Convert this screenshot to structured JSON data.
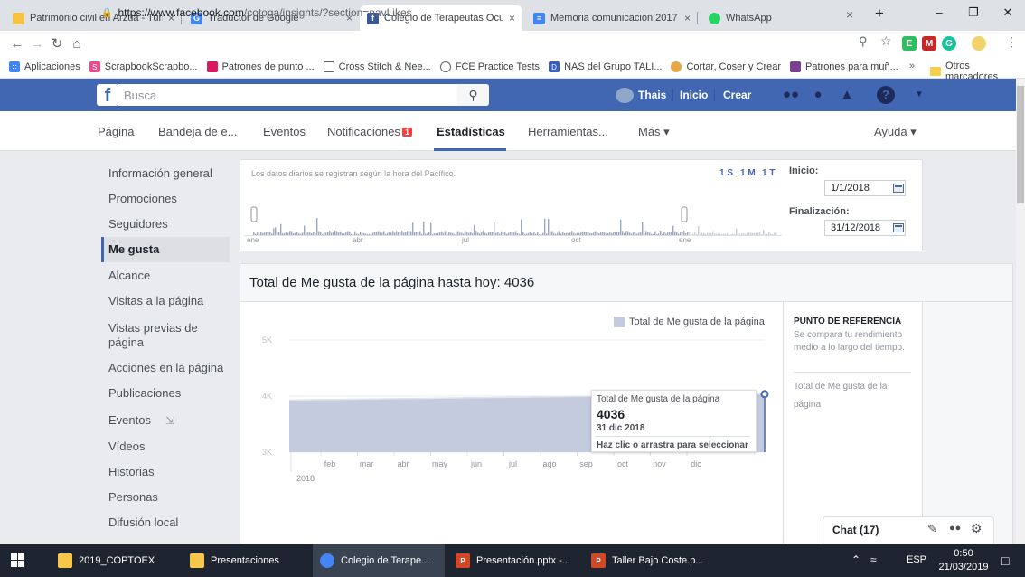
{
  "browser": {
    "tabs": [
      {
        "title": "Patrimonio civil en Arzúa - Turi",
        "close": "×"
      },
      {
        "title": "Traductor de Google",
        "close": "×"
      },
      {
        "title": "Colegio de Terapeutas Ocupac",
        "close": "×"
      },
      {
        "title": "Memoria comunicacion 2017 - ",
        "close": "×"
      },
      {
        "title": "WhatsApp",
        "close": ""
      }
    ],
    "tab_list_close": "×",
    "new_tab": "+",
    "url": "https://www.facebook.com/cotoga/insights/?section=navLikes",
    "url_host": "https://www.facebook.com",
    "url_path": "/cotoga/insights/?section=navLikes",
    "bookmarks": [
      "Aplicaciones",
      "ScrapbookScrapbo...",
      "Patrones de punto ...",
      "Cross Stitch & Nee...",
      "FCE Practice Tests",
      "NAS del Grupo TALI...",
      "Cortar, Coser y Crear",
      "Patrones para muñ..."
    ],
    "bookmarks_more": "»",
    "other_bookmarks": "Otros marcadores"
  },
  "fb_header": {
    "logo": "f",
    "search_placeholder": "Busca",
    "user": "Thais",
    "home": "Inicio",
    "create": "Crear"
  },
  "page_nav": {
    "items": [
      "Página",
      "Bandeja de e...",
      "Eventos",
      "Notificaciones",
      "Estadísticas",
      "Herramientas...",
      "Más ▾"
    ],
    "notifications_badge": "1",
    "help": "Ayuda ▾"
  },
  "left_menu": [
    "Información general",
    "Promociones",
    "Seguidores",
    "Me gusta",
    "Alcance",
    "Visitas a la página",
    "Vistas previas de página",
    "Acciones en la página",
    "Publicaciones",
    "Eventos",
    "Vídeos",
    "Historias",
    "Personas",
    "Difusión local"
  ],
  "date_panel": {
    "note": "Los datos diarios se registran según la hora del Pacífico.",
    "ranges": [
      "1 S",
      "1 M",
      "1 T"
    ],
    "month_labels": [
      "ene",
      "abr",
      "jul",
      "oct",
      "ene"
    ],
    "start_label": "Inicio:",
    "start_date": "1/1/2018",
    "end_label": "Finalización:",
    "end_date": "31/12/2018"
  },
  "likes_panel": {
    "title": "Total de Me gusta de la página hasta hoy: 4036",
    "tooltip_title": "Total de Me gusta de la página",
    "tooltip_value": "4036",
    "tooltip_date": "31 dic 2018",
    "tooltip_action": "Haz clic o arrastra para seleccionar",
    "ref_title": "PUNTO DE REFERENCIA",
    "ref_desc": "Se compara tu rendimiento medio a lo largo del tiempo.",
    "ref_item": "Total de Me gusta de la página"
  },
  "chart_data": {
    "type": "area",
    "title": "",
    "xlabel": "",
    "ylabel": "",
    "legend": "top-right",
    "series": [
      {
        "name": "Total de Me gusta de la página",
        "color": "#c5cbde"
      }
    ],
    "x": [
      "2018-01-01",
      "2018-12-31"
    ],
    "values": [
      3930,
      4036
    ],
    "categories": [
      "feb",
      "mar",
      "abr",
      "may",
      "jun",
      "jul",
      "ago",
      "sep",
      "oct",
      "nov",
      "dic"
    ],
    "year_label": "2018",
    "yticks": [
      "5K",
      "4K",
      "3K"
    ],
    "ylim": [
      3000,
      5000
    ]
  },
  "chat": {
    "label": "Chat (17)"
  },
  "taskbar": {
    "items": [
      "2019_COPTOEX",
      "Presentaciones",
      "Colegio de Terape...",
      "Presentación.pptx -...",
      "Taller Bajo Coste.p..."
    ],
    "lang": "ESP",
    "time": "0:50",
    "date": "21/03/2019"
  }
}
